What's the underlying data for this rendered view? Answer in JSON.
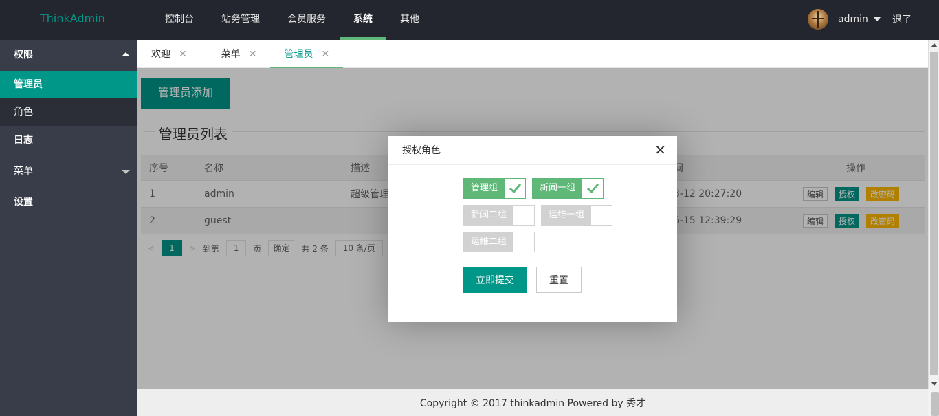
{
  "header": {
    "logo": "ThinkAdmin",
    "nav": [
      "控制台",
      "站务管理",
      "会员服务",
      "系统",
      "其他"
    ],
    "active_nav": "系统",
    "username": "admin",
    "logout": "退了"
  },
  "sidebar": {
    "group": "权限",
    "items": [
      "管理员",
      "角色",
      "日志"
    ],
    "menu": "菜单",
    "settings": "设置"
  },
  "tabs": [
    {
      "label": "欢迎",
      "close": "✕"
    },
    {
      "label": "菜单",
      "close": "✕"
    },
    {
      "label": "管理员",
      "close": "✕"
    }
  ],
  "content": {
    "add_button": "管理员添加",
    "list_title": "管理员列表",
    "columns": [
      "序号",
      "名称",
      "描述",
      "",
      "间",
      "操作"
    ],
    "rows": [
      {
        "id": "1",
        "name": "admin",
        "desc": "超级管理",
        "time": "3-12 20:27:20"
      },
      {
        "id": "2",
        "name": "guest",
        "desc": "",
        "time": "6-15 12:39:29"
      }
    ],
    "row_actions": [
      "编辑",
      "授权",
      "改密码"
    ],
    "pager": {
      "prev": "<",
      "page": "1",
      "next": ">",
      "goto": "到第",
      "goto_value": "1",
      "page_unit": "页",
      "confirm": "确定",
      "total": "共 2 条",
      "per_page": "10 条/页"
    }
  },
  "footer": "Copyright © 2017 thinkadmin Powered by 秀才",
  "modal": {
    "title": "授权角色",
    "close": "✕",
    "roles": [
      {
        "label": "管理组",
        "checked": true
      },
      {
        "label": "新闻一组",
        "checked": true
      },
      {
        "label": "新闻二组",
        "checked": false
      },
      {
        "label": "运维一组",
        "checked": false
      },
      {
        "label": "运维二组",
        "checked": false
      }
    ],
    "submit": "立即提交",
    "reset": "重置"
  }
}
